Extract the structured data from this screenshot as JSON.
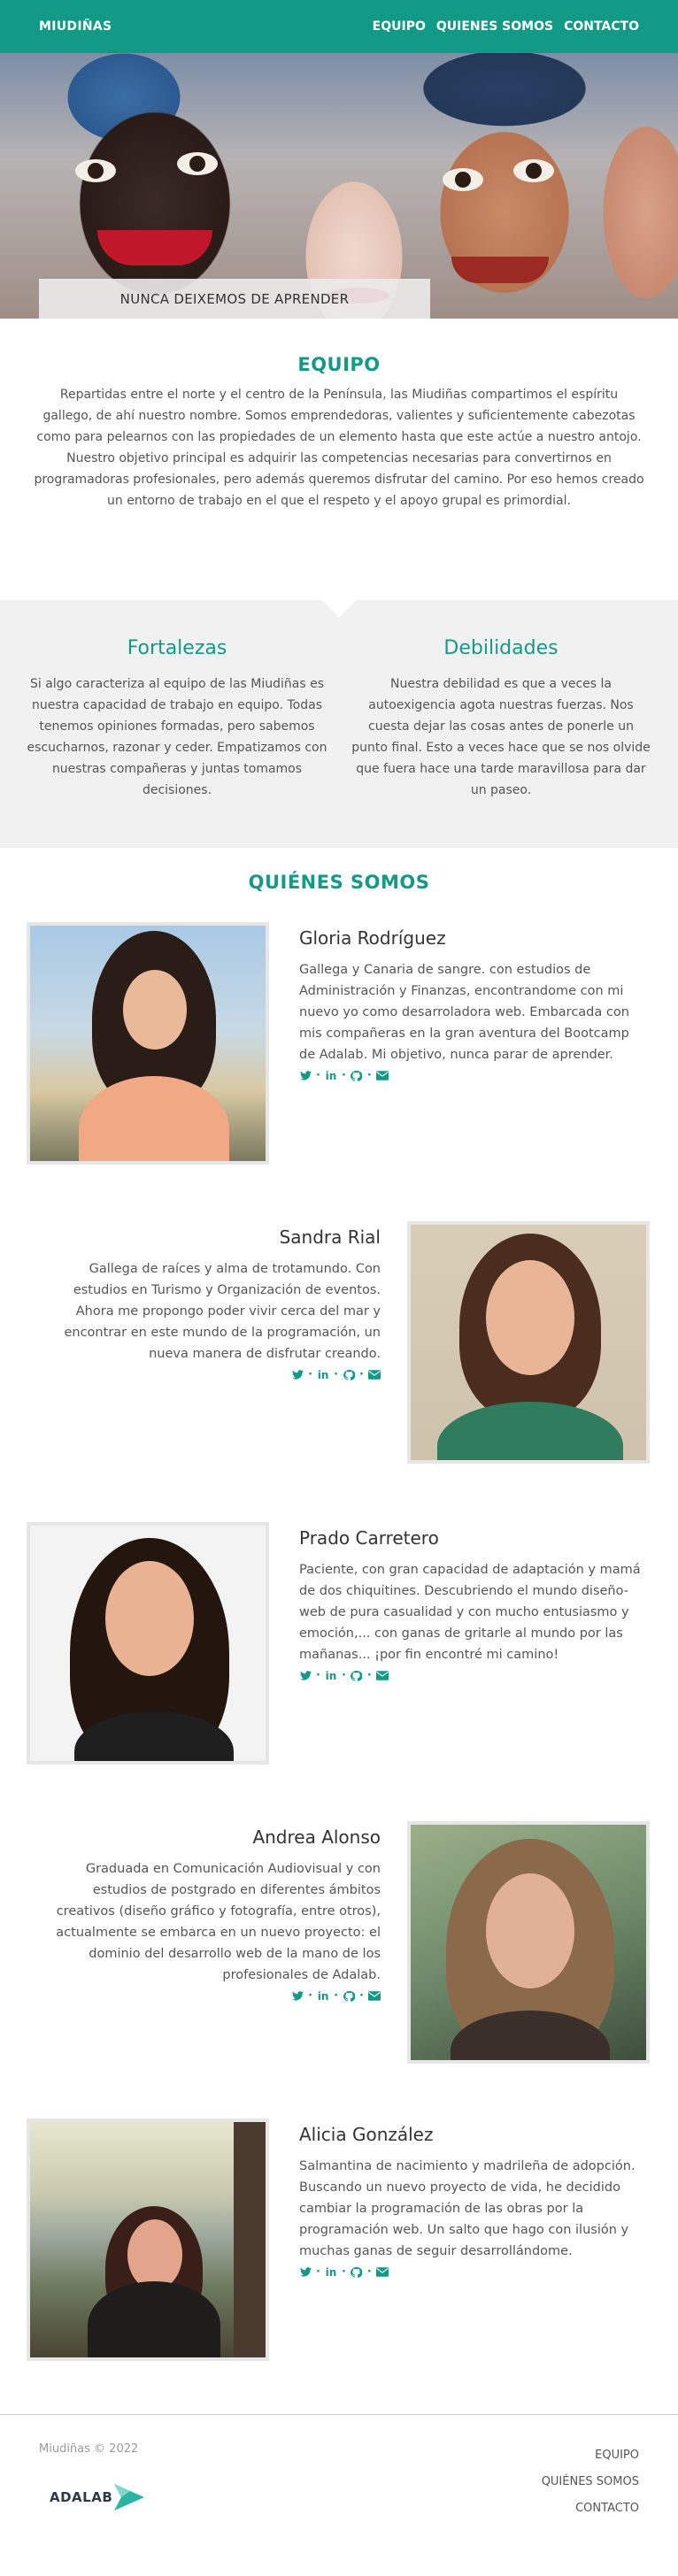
{
  "header": {
    "brand": "MIUDIÑAS",
    "nav": [
      "EQUIPO",
      "QUIENES SOMOS",
      "CONTACTO"
    ]
  },
  "hero": {
    "caption": "NUNCA DEIXEMOS DE APRENDER"
  },
  "equipo": {
    "title": "EQUIPO",
    "paragraph1": "Repartidas entre el norte y el centro de la Península, las Miudiñas compartimos el espíritu gallego, de ahí nuestro nombre. Somos emprendedoras, valientes y suficientemente cabezotas como para pelearnos con las propiedades de un elemento hasta que este actúe a nuestro antojo.",
    "paragraph2": "Nuestro objetivo principal es adquirir las competencias necesarias para convertirnos en programadoras profesionales, pero además queremos disfrutar del camino. Por eso hemos creado un entorno de trabajo en el que el respeto y el apoyo grupal es primordial."
  },
  "fortalezas": {
    "title": "Fortalezas",
    "text": "Si algo caracteriza al equipo de las Miudiñas es nuestra capacidad de trabajo en equipo. Todas tenemos opiniones formadas, pero sabemos escucharnos, razonar y ceder. Empatizamos con nuestras compañeras y juntas tomamos decisiones."
  },
  "debilidades": {
    "title": "Debilidades",
    "text": "Nuestra debilidad es que a veces la autoexigencia agota nuestras fuerzas. Nos cuesta dejar las cosas antes de ponerle un punto final. Esto a veces hace que se nos olvide que fuera hace una tarde maravillosa para dar un paseo."
  },
  "quienes": {
    "title": "QUIÉNES SOMOS",
    "members": [
      {
        "name": "Gloria Rodríguez",
        "bio": "Gallega y Canaria de sangre. con estudios de Administración y Finanzas, encontrandome con mi nuevo yo como desarroladora web. Embarcada con mis compañeras en la gran aventura del Bootcamp de Adalab. Mi objetivo, nunca parar de aprender."
      },
      {
        "name": "Sandra Rial",
        "bio": "Gallega de raíces y alma de trotamundo. Con estudios en Turismo y Organización de eventos. Ahora me propongo poder vivir cerca del mar y encontrar en este mundo de la programación, un nueva manera de disfrutar creando."
      },
      {
        "name": "Prado Carretero",
        "bio": "Paciente, con gran capacidad de adaptación y mamá de dos chiquitines. Descubriendo el mundo diseño-web de pura casualidad y con mucho entusiasmo y emoción,... con ganas de gritarle al mundo por las mañanas... ¡por fin encontré mi camino!"
      },
      {
        "name": "Andrea Alonso",
        "bio": "Graduada en Comunicación Audiovisual y con estudios de postgrado en diferentes ámbitos creativos (diseño gráfico y fotografía, entre otros), actualmente se embarca en un nuevo proyecto: el dominio del desarrollo web de la mano de los profesionales de Adalab."
      },
      {
        "name": "Alicia González",
        "bio": "Salmantina de nacimiento y madrileña de adopción. Buscando un nuevo proyecto de vida, he decidido cambiar la programación de las obras por la programación web. Un salto que hago con ilusión y muchas ganas de seguir desarrollándome."
      }
    ],
    "social_icons": [
      "twitter-icon",
      "linkedin-icon",
      "github-icon",
      "email-icon"
    ]
  },
  "footer": {
    "copyright": "Miudiñas © 2022",
    "logo_text": "ADALAB",
    "nav": [
      "EQUIPO",
      "QUIÉNES SOMOS",
      "CONTACTO"
    ]
  },
  "colors": {
    "accent": "#139a86",
    "section_bg": "#f1f1f1"
  }
}
